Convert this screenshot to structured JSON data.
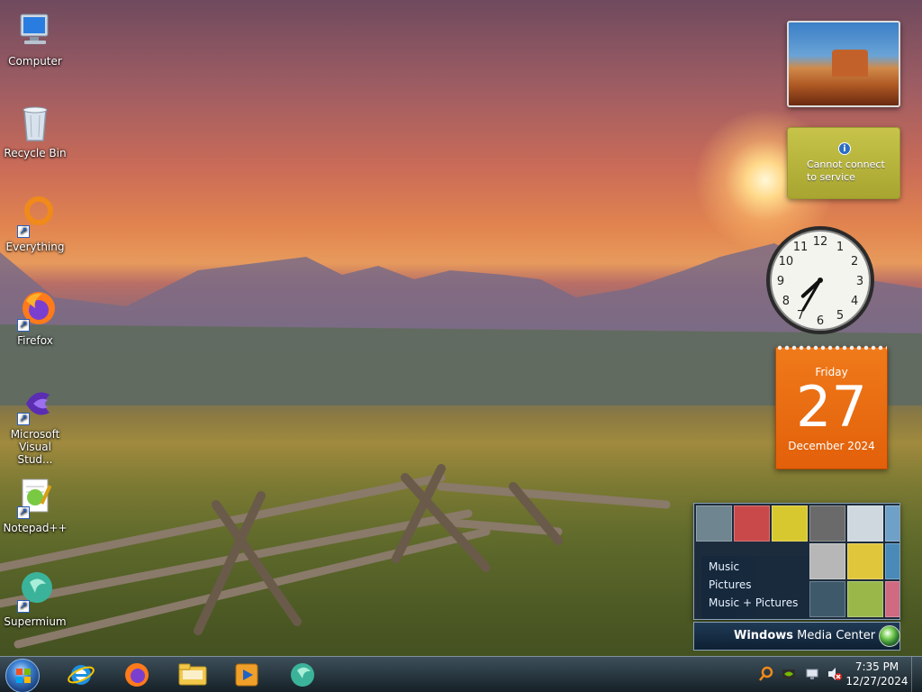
{
  "desktop": {
    "icons": [
      {
        "label": "Computer",
        "icon": "computer-icon"
      },
      {
        "label": "Recycle Bin",
        "icon": "recycle-bin-icon"
      },
      {
        "label": "Everything",
        "icon": "everything-search-icon"
      },
      {
        "label": "Firefox",
        "icon": "firefox-icon"
      },
      {
        "label": "Microsoft Visual Stud...",
        "icon": "visual-studio-icon"
      },
      {
        "label": "Notepad++",
        "icon": "notepad-plus-plus-icon"
      },
      {
        "label": "Supermium",
        "icon": "supermium-icon"
      }
    ]
  },
  "gadgets": {
    "weather": {
      "message": "Cannot connect to service"
    },
    "clock": {
      "hour": 7,
      "minute": 35
    },
    "calendar": {
      "day_of_week": "Friday",
      "day": "27",
      "month_year": "December 2024"
    },
    "media_center": {
      "items": [
        "Music",
        "Pictures",
        "Music + Pictures"
      ],
      "title_bold": "Windows",
      "title_rest": " Media Center"
    }
  },
  "taskbar": {
    "pinned": [
      "internet-explorer-icon",
      "firefox-icon",
      "file-explorer-icon",
      "media-player-icon",
      "supermium-icon"
    ],
    "tray_icons": [
      "everything-search-icon",
      "nvidia-icon",
      "network-icon",
      "volume-muted-icon"
    ],
    "time": "7:35 PM",
    "date": "12/27/2024"
  },
  "colors": {
    "calendar_orange": "#e8690f",
    "weather_yellow": "#b8b53a",
    "taskbar_dark": "#1e2b38"
  }
}
